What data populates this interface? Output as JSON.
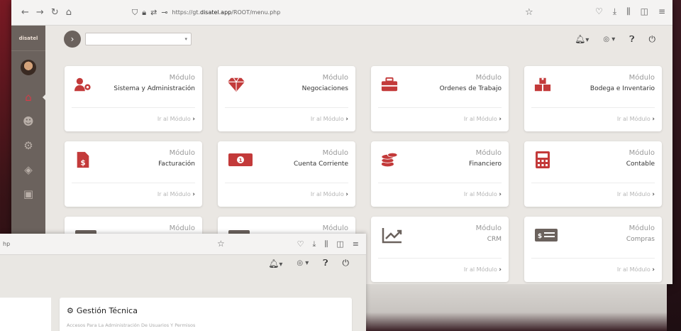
{
  "browser_back": {
    "url_prefix": "https://gt.",
    "url_domain": "disatel.app",
    "url_path": "/ROOT/menu.php"
  },
  "sidebar": {
    "logo_text": "disatel"
  },
  "modules": [
    {
      "kicker": "Módulo",
      "name": "Sistema y Administración",
      "link": "Ir al Módulo",
      "icon": "user-gear-icon",
      "icon_color": "#c33a3a"
    },
    {
      "kicker": "Módulo",
      "name": "Negociaciones",
      "link": "Ir al Módulo",
      "icon": "diamond-icon",
      "icon_color": "#c33a3a"
    },
    {
      "kicker": "Módulo",
      "name": "Ordenes de Trabajo",
      "link": "Ir al Módulo",
      "icon": "toolbox-icon",
      "icon_color": "#c33a3a"
    },
    {
      "kicker": "Módulo",
      "name": "Bodega e Inventario",
      "link": "Ir al Módulo",
      "icon": "boxes-icon",
      "icon_color": "#c33a3a"
    },
    {
      "kicker": "Módulo",
      "name": "Facturación",
      "link": "Ir al Módulo",
      "icon": "invoice-icon",
      "icon_color": "#c33a3a"
    },
    {
      "kicker": "Módulo",
      "name": "Cuenta Corriente",
      "link": "Ir al Módulo",
      "icon": "money-bill-icon",
      "icon_color": "#c33a3a"
    },
    {
      "kicker": "Módulo",
      "name": "Financiero",
      "link": "Ir al Módulo",
      "icon": "coins-icon",
      "icon_color": "#c33a3a"
    },
    {
      "kicker": "Módulo",
      "name": "Contable",
      "link": "Ir al Módulo",
      "icon": "calculator-icon",
      "icon_color": "#c33a3a"
    },
    {
      "kicker": "Módulo",
      "name": "",
      "link": "",
      "icon": "card-icon",
      "icon_color": "#6b625d"
    },
    {
      "kicker": "Módulo",
      "name": "",
      "link": "",
      "icon": "card-icon",
      "icon_color": "#6b625d"
    },
    {
      "kicker": "Módulo",
      "name": "CRM",
      "link": "Ir al Módulo",
      "icon": "chart-line-icon",
      "icon_color": "#6b625d"
    },
    {
      "kicker": "Módulo",
      "name": "Compras",
      "link": "Ir al Módulo",
      "icon": "money-card-icon",
      "icon_color": "#6b625d"
    }
  ],
  "front_window": {
    "url_fragment": "hp",
    "section_title": "Gestión Técnica",
    "section_subtitle": "Accesos Para La Administración De Usuarios Y Permisos"
  }
}
